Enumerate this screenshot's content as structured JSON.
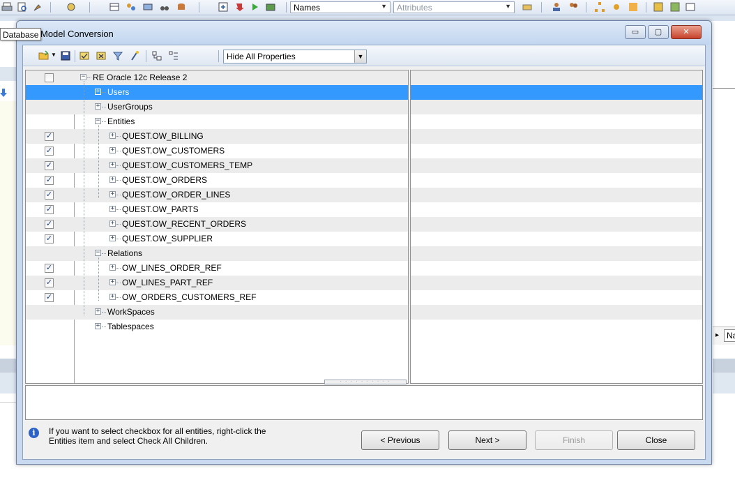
{
  "app": {
    "names_combo": "Names",
    "attributes_combo": "Attributes",
    "right_tab_label": "Na"
  },
  "tooltip": "Database",
  "dialog": {
    "title": "Model Conversion",
    "window_buttons": {
      "minimize": "▭",
      "maximize": "▢",
      "close": "✕"
    },
    "toolbar": {
      "properties_select": "Hide All Properties"
    },
    "tree": [
      {
        "id": "root",
        "label": "RE Oracle 12c Release 2",
        "level": 0,
        "checkbox": "unchecked",
        "expander": "minus"
      },
      {
        "id": "users",
        "label": "Users",
        "level": 1,
        "checkbox": "none",
        "expander": "plus",
        "selected": true
      },
      {
        "id": "usergroups",
        "label": "UserGroups",
        "level": 1,
        "checkbox": "none",
        "expander": "plus"
      },
      {
        "id": "entities",
        "label": "Entities",
        "level": 1,
        "checkbox": "none",
        "expander": "minus"
      },
      {
        "id": "e1",
        "label": "QUEST.OW_BILLING",
        "level": 2,
        "checkbox": "checked",
        "expander": "plus"
      },
      {
        "id": "e2",
        "label": "QUEST.OW_CUSTOMERS",
        "level": 2,
        "checkbox": "checked",
        "expander": "plus"
      },
      {
        "id": "e3",
        "label": "QUEST.OW_CUSTOMERS_TEMP",
        "level": 2,
        "checkbox": "checked",
        "expander": "plus"
      },
      {
        "id": "e4",
        "label": "QUEST.OW_ORDERS",
        "level": 2,
        "checkbox": "checked",
        "expander": "plus"
      },
      {
        "id": "e5",
        "label": "QUEST.OW_ORDER_LINES",
        "level": 2,
        "checkbox": "checked",
        "expander": "plus"
      },
      {
        "id": "e6",
        "label": "QUEST.OW_PARTS",
        "level": 2,
        "checkbox": "checked",
        "expander": "plus"
      },
      {
        "id": "e7",
        "label": "QUEST.OW_RECENT_ORDERS",
        "level": 2,
        "checkbox": "checked",
        "expander": "plus"
      },
      {
        "id": "e8",
        "label": "QUEST.OW_SUPPLIER",
        "level": 2,
        "checkbox": "checked",
        "expander": "plus"
      },
      {
        "id": "relations",
        "label": "Relations",
        "level": 1,
        "checkbox": "none",
        "expander": "minus"
      },
      {
        "id": "r1",
        "label": "OW_LINES_ORDER_REF",
        "level": 2,
        "checkbox": "checked",
        "expander": "plus"
      },
      {
        "id": "r2",
        "label": "OW_LINES_PART_REF",
        "level": 2,
        "checkbox": "checked",
        "expander": "plus"
      },
      {
        "id": "r3",
        "label": "OW_ORDERS_CUSTOMERS_REF",
        "level": 2,
        "checkbox": "checked",
        "expander": "plus"
      },
      {
        "id": "workspaces",
        "label": "WorkSpaces",
        "level": 1,
        "checkbox": "none",
        "expander": "plus"
      },
      {
        "id": "tablespaces",
        "label": "Tablespaces",
        "level": 1,
        "checkbox": "none",
        "expander": "plus"
      }
    ],
    "info_text": "If you want to select checkbox for all entities, right-click the Entities item and select Check All Children.",
    "buttons": {
      "previous": "< Previous",
      "next": "Next >",
      "finish": "Finish",
      "close": "Close"
    },
    "finish_enabled": false
  },
  "colors": {
    "selection": "#3399ff",
    "dialog_frame": "#c9daf0",
    "alt_row": "#ececec"
  }
}
